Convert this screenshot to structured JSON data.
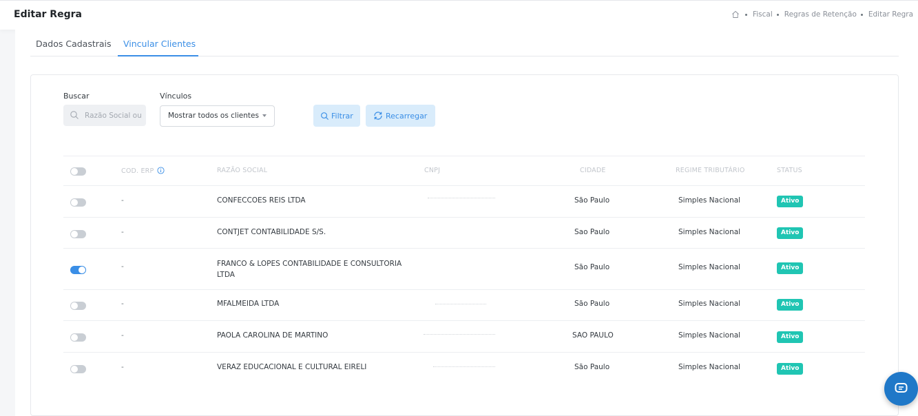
{
  "header": {
    "title": "Editar Regra",
    "breadcrumb": [
      "Fiscal",
      "Regras de Retenção",
      "Editar Regra"
    ]
  },
  "tabs": [
    {
      "label": "Dados Cadastrais",
      "active": false
    },
    {
      "label": "Vincular Clientes",
      "active": true
    }
  ],
  "filters": {
    "search_label": "Buscar",
    "search_placeholder": "Razão Social ou CNPJ",
    "vinculos_label": "Vínculos",
    "vinculos_value": "Mostrar todos os clientes",
    "filter_button": "Filtrar",
    "reload_button": "Recarregar"
  },
  "table": {
    "columns": [
      "COD. ERP",
      "RAZÃO SOCIAL",
      "CNPJ",
      "CIDADE",
      "REGIME TRIBUTÁRIO",
      "STATUS"
    ],
    "rows": [
      {
        "linked": false,
        "code": "-",
        "name": "CONFECCOES REIS LTDA",
        "city": "São Paulo",
        "regime": "Simples Nacional",
        "status": "Ativo"
      },
      {
        "linked": false,
        "code": "-",
        "name": "CONTJET CONTABILIDADE S/S.",
        "city": "Sao Paulo",
        "regime": "Simples Nacional",
        "status": "Ativo"
      },
      {
        "linked": true,
        "code": "-",
        "name": "FRANCO & LOPES CONTABILIDADE E CONSULTORIA LTDA",
        "city": "São Paulo",
        "regime": "Simples Nacional",
        "status": "Ativo"
      },
      {
        "linked": false,
        "code": "-",
        "name": "MFALMEIDA LTDA",
        "city": "São Paulo",
        "regime": "Simples Nacional",
        "status": "Ativo"
      },
      {
        "linked": false,
        "code": "-",
        "name": "PAOLA CAROLINA DE MARTINO",
        "city": "SAO PAULO",
        "regime": "Simples Nacional",
        "status": "Ativo"
      },
      {
        "linked": false,
        "code": "-",
        "name": "VERAZ EDUCACIONAL E CULTURAL EIRELI",
        "city": "São Paulo",
        "regime": "Simples Nacional",
        "status": "Ativo"
      }
    ]
  },
  "colors": {
    "accent": "#3a8ee6",
    "status_active": "#20c5b3",
    "chat_button": "#1f78c8"
  },
  "icons": [
    "home-icon",
    "search-icon",
    "info-icon",
    "refresh-icon",
    "chat-icon"
  ]
}
